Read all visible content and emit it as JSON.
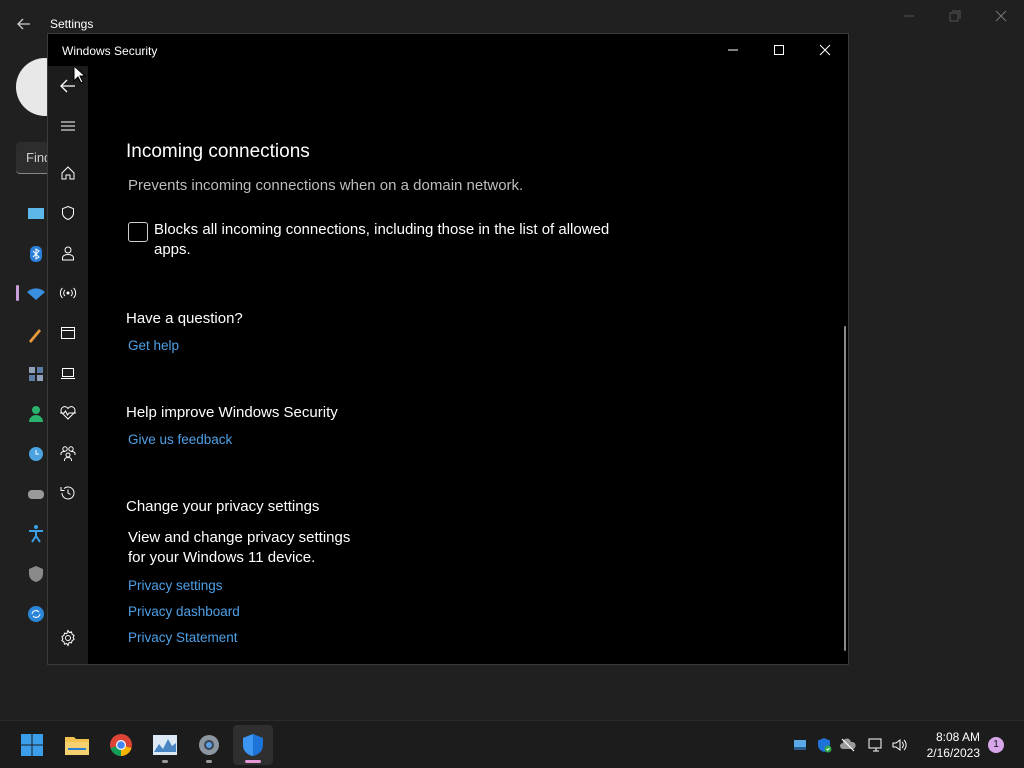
{
  "settings": {
    "title": "Settings",
    "search_placeholder": "Find"
  },
  "window": {
    "title": "Windows Security"
  },
  "content": {
    "incoming": {
      "heading": "Incoming connections",
      "description": "Prevents incoming connections when on a domain network.",
      "checkbox_label": "Blocks all incoming connections, including those in the list of allowed apps.",
      "checked": false
    },
    "question": {
      "heading": "Have a question?",
      "link": "Get help"
    },
    "improve": {
      "heading": "Help improve Windows Security",
      "link": "Give us feedback"
    },
    "privacy": {
      "heading": "Change your privacy settings",
      "description_line1": "View and change privacy settings",
      "description_line2": "for your Windows 11 device.",
      "links": [
        "Privacy settings",
        "Privacy dashboard",
        "Privacy Statement"
      ]
    }
  },
  "rail_icons": [
    "back-icon",
    "menu-icon",
    "home-icon",
    "shield-icon",
    "account-icon",
    "network-icon",
    "app-browser-icon",
    "device-icon",
    "health-icon",
    "family-icon",
    "history-icon",
    "settings-gear-icon"
  ],
  "taskbar": {
    "time": "8:08 AM",
    "date": "2/16/2023",
    "notification_count": "1"
  },
  "colors": {
    "link": "#4ea0e6",
    "accent_active": "#e597d6",
    "window_bg": "#000000"
  }
}
